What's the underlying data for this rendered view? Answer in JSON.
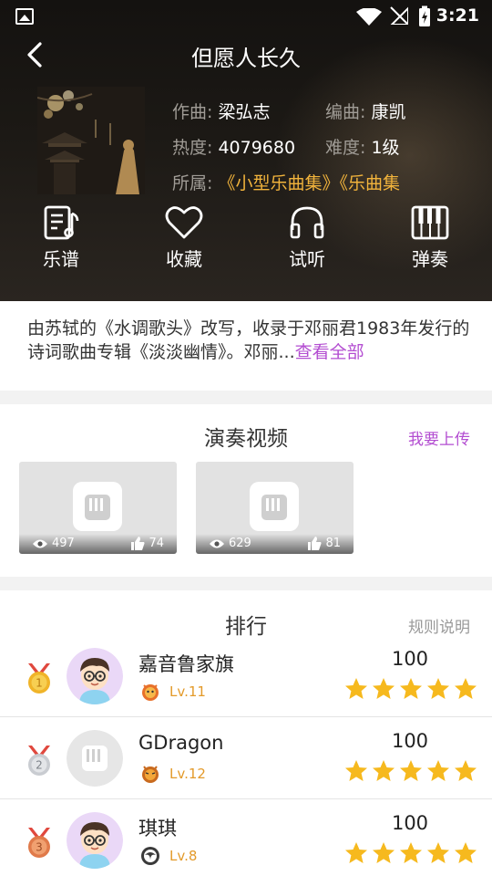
{
  "status_bar": {
    "time": "3:21"
  },
  "header": {
    "title": "但愿人长久",
    "info": {
      "composer_label": "作曲:",
      "composer": "梁弘志",
      "arranger_label": "编曲:",
      "arranger": "康凯",
      "heat_label": "热度:",
      "heat": "4079680",
      "difficulty_label": "难度:",
      "difficulty": "1级",
      "belongs_label": "所属:",
      "collection_1": "《小型乐曲集》",
      "collection_2": "《乐曲集"
    },
    "actions": [
      {
        "label": "乐谱",
        "icon": "sheet-music-icon"
      },
      {
        "label": "收藏",
        "icon": "heart-icon"
      },
      {
        "label": "试听",
        "icon": "headphones-icon"
      },
      {
        "label": "弹奏",
        "icon": "piano-icon"
      }
    ]
  },
  "description": {
    "text": "由苏轼的《水调歌头》改写，收录于邓丽君1983年发行的诗词歌曲专辑《淡淡幽情》。邓丽...",
    "more": "查看全部"
  },
  "videos": {
    "title": "演奏视频",
    "upload": "我要上传",
    "items": [
      {
        "views": "497",
        "likes": "74"
      },
      {
        "views": "629",
        "likes": "81"
      }
    ]
  },
  "ranking": {
    "title": "排行",
    "rules": "规则说明",
    "rows": [
      {
        "rank": "1",
        "name": "嘉音鲁家旗",
        "level": "Lv.11",
        "score": "100",
        "stars": 5,
        "medal_color": "#f0b429",
        "ribbon_color": "#e0483e",
        "avatar": "cartoon-boy"
      },
      {
        "rank": "2",
        "name": "GDragon",
        "level": "Lv.12",
        "score": "100",
        "stars": 5,
        "medal_color": "#c9ccd1",
        "ribbon_color": "#e0483e",
        "avatar": "default-piano"
      },
      {
        "rank": "3",
        "name": "琪琪",
        "level": "Lv.8",
        "score": "100",
        "stars": 5,
        "medal_color": "#e07a4a",
        "ribbon_color": "#e0483e",
        "avatar": "cartoon-boy"
      }
    ]
  },
  "colors": {
    "accent_purple": "#b34dd1",
    "gold": "#f2b43c",
    "star": "#f6b91e",
    "level": "#e39a2a"
  }
}
